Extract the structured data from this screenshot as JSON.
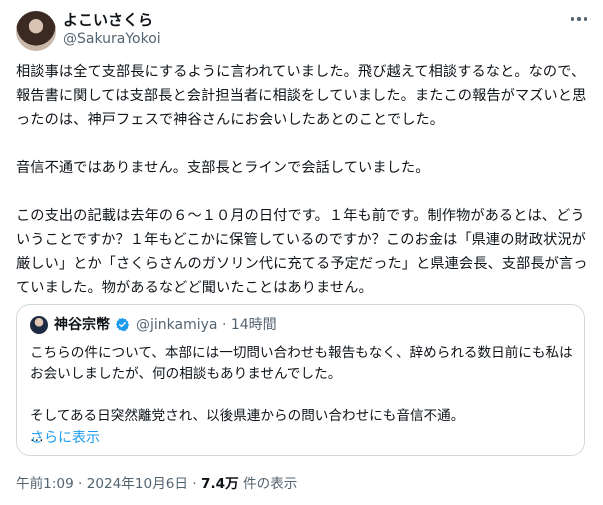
{
  "author": {
    "display_name": "よこいさくら",
    "handle": "@SakuraYokoi"
  },
  "post": {
    "text": "相談事は全て支部長にするように言われていました。飛び越えて相談するなと。なので、報告書に関しては支部長と会計担当者に相談をしていました。またこの報告がマズいと思ったのは、神戸フェスで神谷さんにお会いしたあとのことでした。\n\n音信不通ではありません。支部長とラインで会話していました。\n\nこの支出の記載は去年の６〜１０月の日付です。１年も前です。制作物があるとは、どういうことですか？１年もどこかに保管しているのですか？このお金は「県連の財政状況が厳しい」とか「さくらさんのガソリン代に充てる予定だった」と県連会長、支部長が言っていました。物があるなどど聞いたことはありません。"
  },
  "quoted": {
    "display_name": "神谷宗幣",
    "handle": "@jinkamiya",
    "separator": "·",
    "time": "14時間",
    "text": "こちらの件について、本部には一切問い合わせも報告もなく、辞められる数日前にも私はお会いしましたが、何の相談もありませんでした。\n\nそしてある日突然離党され、以後県連からの問い合わせにも音信不通。\n…",
    "show_more": "さらに表示",
    "verified_color": "#1d9bf0"
  },
  "footer": {
    "time": "午前1:09",
    "sep1": "·",
    "date": "2024年10月6日",
    "sep2": "·",
    "views_count": "7.4万",
    "views_label": "件の表示"
  }
}
